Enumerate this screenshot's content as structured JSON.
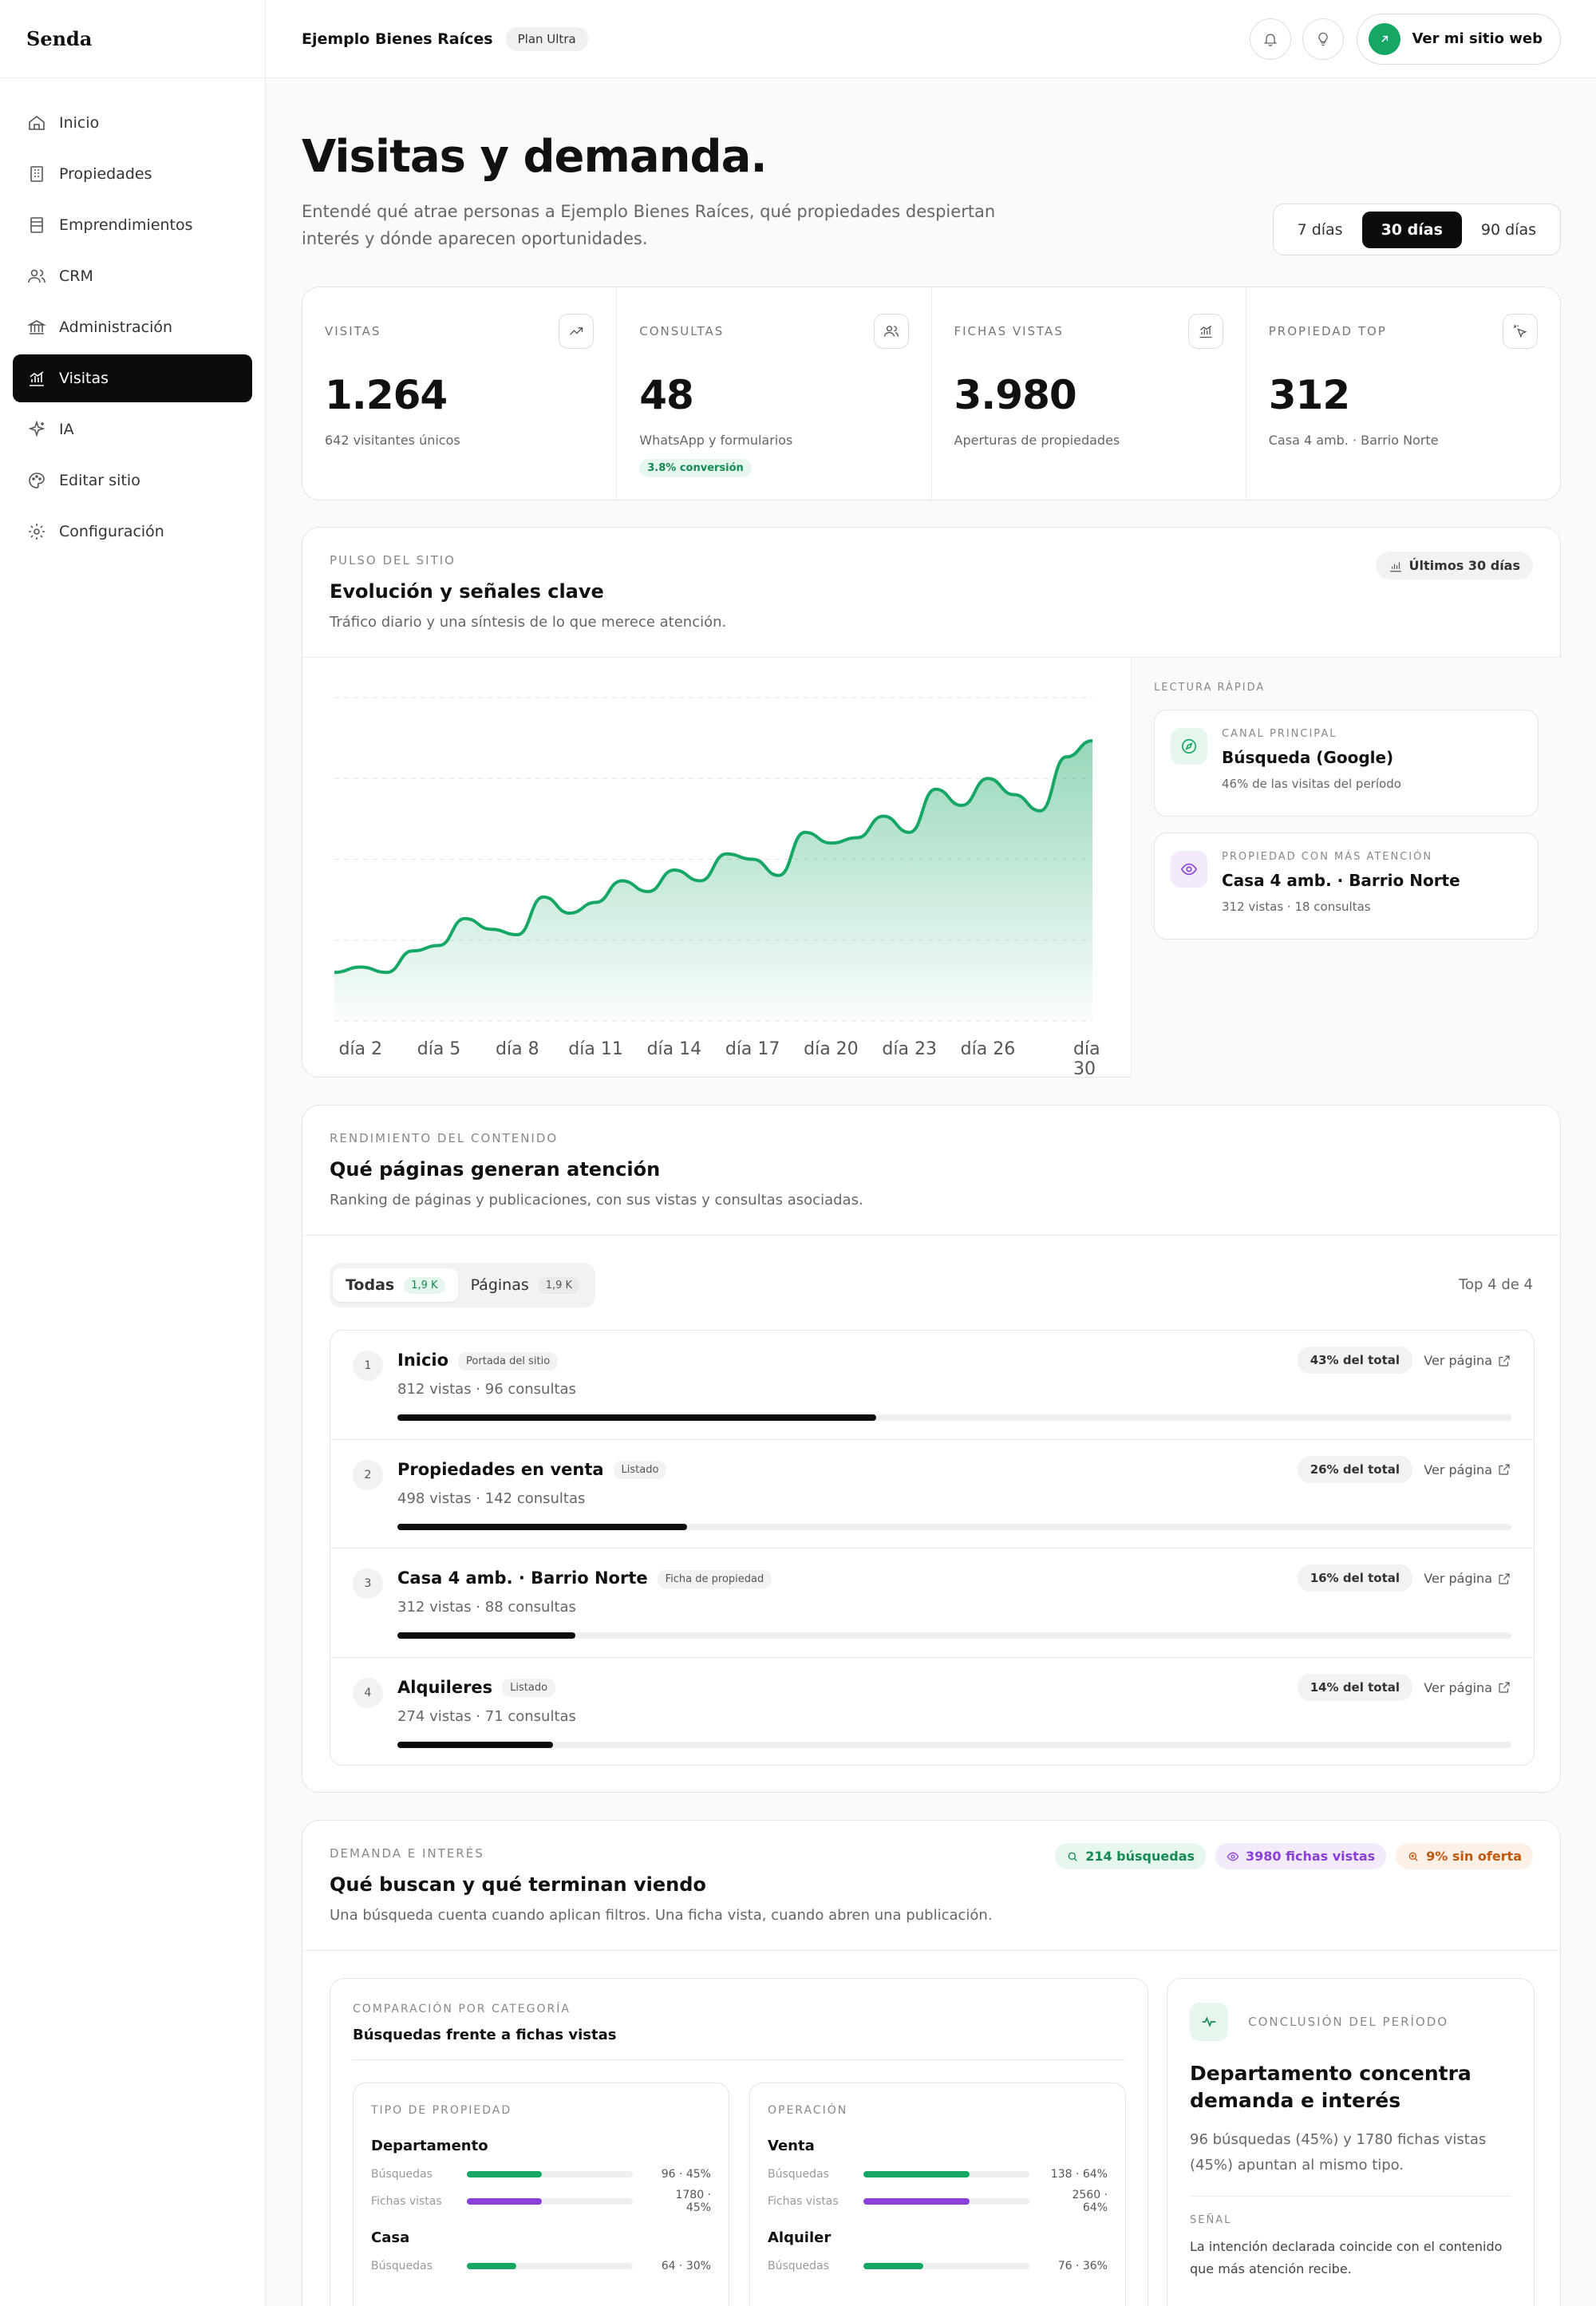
{
  "brand": "Senda",
  "nav": [
    {
      "label": "Inicio",
      "icon": "home-icon"
    },
    {
      "label": "Propiedades",
      "icon": "building-icon"
    },
    {
      "label": "Emprendimientos",
      "icon": "tower-icon"
    },
    {
      "label": "CRM",
      "icon": "users-icon"
    },
    {
      "label": "Administración",
      "icon": "bank-icon"
    },
    {
      "label": "Visitas",
      "icon": "chart-icon",
      "active": true
    },
    {
      "label": "IA",
      "icon": "sparkle-icon"
    },
    {
      "label": "Editar sitio",
      "icon": "palette-icon"
    },
    {
      "label": "Configuración",
      "icon": "gear-icon"
    }
  ],
  "topbar": {
    "org": "Ejemplo Bienes Raíces",
    "plan": "Plan Ultra",
    "site_button": "Ver mi sitio web"
  },
  "page": {
    "title": "Visitas y demanda.",
    "lead": "Entendé qué atrae personas a Ejemplo Bienes Raíces, qué propiedades despiertan interés y dónde aparecen oportunidades.",
    "ranges": [
      "7 días",
      "30 días",
      "90 días"
    ],
    "active_range": "30 días"
  },
  "kpis": [
    {
      "label": "VISITAS",
      "value": "1.264",
      "sub": "642 visitantes únicos",
      "icon": "trend-up-icon"
    },
    {
      "label": "CONSULTAS",
      "value": "48",
      "sub": "WhatsApp y formularios",
      "badge": "3.8% conversión",
      "icon": "users-icon"
    },
    {
      "label": "FICHAS VISTAS",
      "value": "3.980",
      "sub": "Aperturas de propiedades",
      "icon": "chart-icon"
    },
    {
      "label": "PROPIEDAD TOP",
      "value": "312",
      "sub": "Casa 4 amb. · Barrio Norte",
      "icon": "pointer-click-icon"
    }
  ],
  "pulse": {
    "label": "PULSO DEL SITIO",
    "title": "Evolución y señales clave",
    "desc": "Tráfico diario y una síntesis de lo que merece atención.",
    "pill": "Últimos 30 días",
    "quick_label": "LECTURA RÁPIDA",
    "quick": [
      {
        "label": "CANAL PRINCIPAL",
        "title": "Búsqueda (Google)",
        "sub": "46% de las visitas del período",
        "icon": "compass-icon",
        "color": "#16a765",
        "bg": "#e6f7ee"
      },
      {
        "label": "PROPIEDAD CON MÁS ATENCIÓN",
        "title": "Casa 4 amb. · Barrio Norte",
        "sub": "312 vistas · 18 consultas",
        "icon": "eye-icon",
        "color": "#8b3fd9",
        "bg": "#f3ebfc"
      }
    ]
  },
  "chart_data": {
    "type": "area",
    "x": [
      1,
      2,
      3,
      4,
      5,
      6,
      7,
      8,
      9,
      10,
      11,
      12,
      13,
      14,
      15,
      16,
      17,
      18,
      19,
      20,
      21,
      22,
      23,
      24,
      25,
      26,
      27,
      28,
      29,
      30
    ],
    "x_tick_labels": [
      "día 2",
      "día 5",
      "día 8",
      "día 11",
      "día 14",
      "día 17",
      "día 20",
      "día 23",
      "día 26",
      "día 30"
    ],
    "x_tick_values": [
      2,
      5,
      8,
      11,
      14,
      17,
      20,
      23,
      26,
      30
    ],
    "values": [
      9,
      10,
      9,
      13,
      14,
      19,
      17,
      16,
      23,
      20,
      22,
      26,
      24,
      28,
      26,
      31,
      30,
      27,
      35,
      33,
      34,
      38,
      35,
      43,
      40,
      45,
      42,
      39,
      49,
      52
    ],
    "ylim": [
      0,
      60
    ],
    "grid": true,
    "color": "#16a765"
  },
  "performance": {
    "label": "RENDIMIENTO DEL CONTENIDO",
    "title": "Qué páginas generan atención",
    "desc": "Ranking de páginas y publicaciones, con sus vistas y consultas asociadas.",
    "tabs": [
      {
        "label": "Todas",
        "count": "1,9 K"
      },
      {
        "label": "Páginas",
        "count": "1,9 K"
      }
    ],
    "top": "Top 4 de 4",
    "link_label": "Ver página",
    "rows": [
      {
        "rank": "1",
        "name": "Inicio",
        "tag": "Portada del sitio",
        "stats": "812 vistas · 96 consultas",
        "pct": "43% del total",
        "share": 0.43
      },
      {
        "rank": "2",
        "name": "Propiedades en venta",
        "tag": "Listado",
        "stats": "498 vistas · 142 consultas",
        "pct": "26% del total",
        "share": 0.26
      },
      {
        "rank": "3",
        "name": "Casa 4 amb. · Barrio Norte",
        "tag": "Ficha de propiedad",
        "stats": "312 vistas · 88 consultas",
        "pct": "16% del total",
        "share": 0.16
      },
      {
        "rank": "4",
        "name": "Alquileres",
        "tag": "Listado",
        "stats": "274 vistas · 71 consultas",
        "pct": "14% del total",
        "share": 0.14
      }
    ]
  },
  "demand": {
    "label": "DEMANDA E INTERÉS",
    "title": "Qué buscan y qué terminan viendo",
    "desc": "Una búsqueda cuenta cuando aplican filtros. Una ficha vista, cuando abren una publicación.",
    "chips": [
      {
        "text": "214 búsquedas",
        "icon": "search-icon",
        "color": "#138a52",
        "bg": "#e6f7ee"
      },
      {
        "text": "3980 fichas vistas",
        "icon": "eye-icon",
        "color": "#8b3fd9",
        "bg": "#f3ebfc"
      },
      {
        "text": "9% sin oferta",
        "icon": "search-x-icon",
        "color": "#c2570c",
        "bg": "#fdf0e6"
      }
    ],
    "compare_label": "COMPARACIÓN POR CATEGORÍA",
    "compare_title": "Búsquedas frente a fichas vistas",
    "searches_label": "Búsquedas",
    "views_label": "Fichas vistas",
    "groups": [
      {
        "label": "TIPO DE PROPIEDAD",
        "items": [
          {
            "name": "Departamento",
            "search": "96 · 45%",
            "search_share": 0.45,
            "views": "1780 · 45%",
            "views_share": 0.45
          },
          {
            "name": "Casa",
            "search": "64 · 30%",
            "search_share": 0.3
          }
        ]
      },
      {
        "label": "OPERACIÓN",
        "items": [
          {
            "name": "Venta",
            "search": "138 · 64%",
            "search_share": 0.64,
            "views": "2560 · 64%",
            "views_share": 0.64
          },
          {
            "name": "Alquiler",
            "search": "76 · 36%",
            "search_share": 0.36
          }
        ]
      }
    ],
    "conclusion": {
      "label": "CONCLUSIÓN DEL PERÍODO",
      "title": "Departamento concentra demanda e interés",
      "desc": "96 búsquedas (45%) y 1780 fichas vistas (45%) apuntan al mismo tipo.",
      "signal_label": "SEÑAL",
      "signal": "La intención declarada coincide con el contenido que más atención recibe."
    }
  }
}
